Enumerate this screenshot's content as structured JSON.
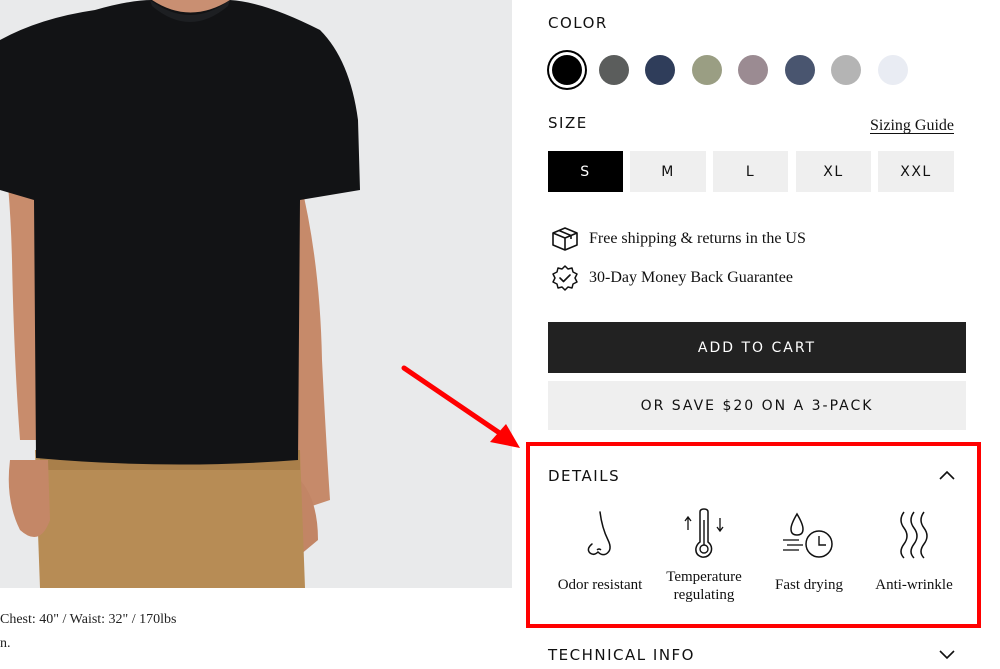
{
  "product_image": {
    "caption_line1": "Chest: 40\" / Waist: 32\" / 170lbs",
    "caption_line2": "n."
  },
  "color": {
    "label": "COLOR",
    "swatches": [
      "#000000",
      "#5b5d5c",
      "#2f3d5a",
      "#9a9e83",
      "#9b8b92",
      "#49556f",
      "#b4b4b4",
      "#e9ecf3"
    ],
    "selected_index": 0
  },
  "size": {
    "label": "SIZE",
    "guide_link": "Sizing Guide",
    "options": [
      "S",
      "M",
      "L",
      "XL",
      "XXL"
    ],
    "selected": "S"
  },
  "perks": {
    "shipping": "Free shipping & returns in the US",
    "guarantee": "30-Day Money Back Guarantee"
  },
  "buttons": {
    "add_to_cart": "ADD TO CART",
    "three_pack": "OR SAVE $20 ON A 3-PACK"
  },
  "details": {
    "title": "DETAILS",
    "features": [
      {
        "icon": "nose-icon",
        "label": "Odor resistant"
      },
      {
        "icon": "thermometer-icon",
        "label": "Temperature regulating"
      },
      {
        "icon": "droplet-clock-icon",
        "label": "Fast drying"
      },
      {
        "icon": "wavy-lines-icon",
        "label": "Anti-wrinkle"
      }
    ]
  },
  "technical_info": {
    "title": "TECHNICAL INFO"
  },
  "annotation": {
    "arrow_color": "#ff0000",
    "box_color": "#ff0000"
  }
}
